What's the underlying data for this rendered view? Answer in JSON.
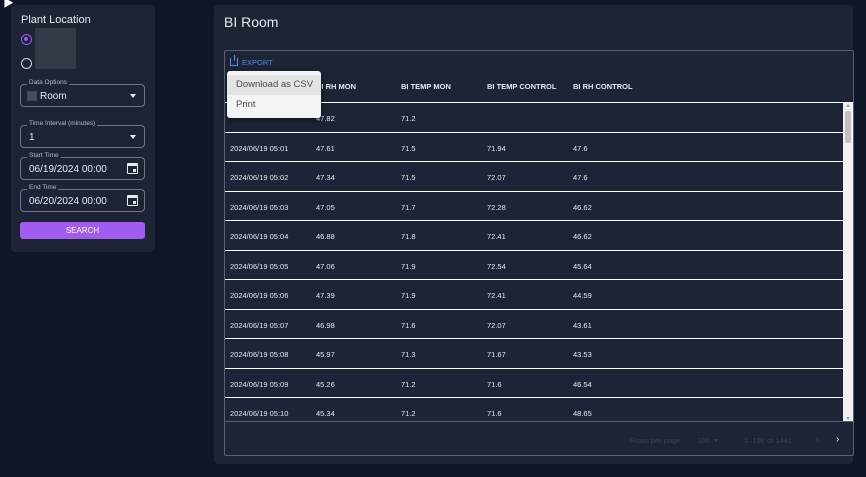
{
  "left_panel": {
    "title": "Plant Location",
    "data_options": {
      "label": "Data Options",
      "value": "Room"
    },
    "time_interval": {
      "label": "Time Interval (minutes)",
      "value": "1"
    },
    "start_time": {
      "label": "Start Time",
      "value": "06/19/2024 00:00"
    },
    "end_time": {
      "label": "End Time",
      "value": "06/20/2024 00:00"
    },
    "search_label": "SEARCH"
  },
  "main": {
    "title": "BI Room",
    "export_label": "EXPORT",
    "columns": [
      "",
      "BI RH MON",
      "BI TEMP MON",
      "BI TEMP CONTROL",
      "BI RH CONTROL"
    ],
    "rows": [
      [
        "",
        "47.82",
        "71.2",
        "",
        ""
      ],
      [
        "2024/06/19 05:01",
        "47.61",
        "71.5",
        "71.94",
        "47.6"
      ],
      [
        "2024/06/19 05:02",
        "47.34",
        "71.5",
        "72.07",
        "47.6"
      ],
      [
        "2024/06/19 05:03",
        "47.05",
        "71.7",
        "72.28",
        "46.62"
      ],
      [
        "2024/06/19 05:04",
        "46.88",
        "71.8",
        "72.41",
        "46.62"
      ],
      [
        "2024/06/19 05:05",
        "47.06",
        "71.9",
        "72.54",
        "45.64"
      ],
      [
        "2024/06/19 05:06",
        "47.39",
        "71.9",
        "72.41",
        "44.59"
      ],
      [
        "2024/06/19 05:07",
        "46.98",
        "71.6",
        "72.07",
        "43.61"
      ],
      [
        "2024/06/19 05:08",
        "45.97",
        "71.3",
        "71.67",
        "43.53"
      ],
      [
        "2024/06/19 05:09",
        "45.26",
        "71.2",
        "71.6",
        "46.54"
      ],
      [
        "2024/06/19 05:10",
        "45.34",
        "71.2",
        "71.6",
        "48.65"
      ]
    ],
    "footer": {
      "rows_per_page_label": "Rows per page:",
      "rows_per_page_value": "100",
      "range": "1–100 of 1441",
      "prev_icon": "‹",
      "next_icon": "›"
    }
  },
  "export_menu": {
    "items": [
      "Download as CSV",
      "Print"
    ]
  },
  "colors": {
    "background": "#0f1626",
    "panel": "#1d2435",
    "accent": "#a35cf0",
    "link": "#4e8ff0"
  }
}
